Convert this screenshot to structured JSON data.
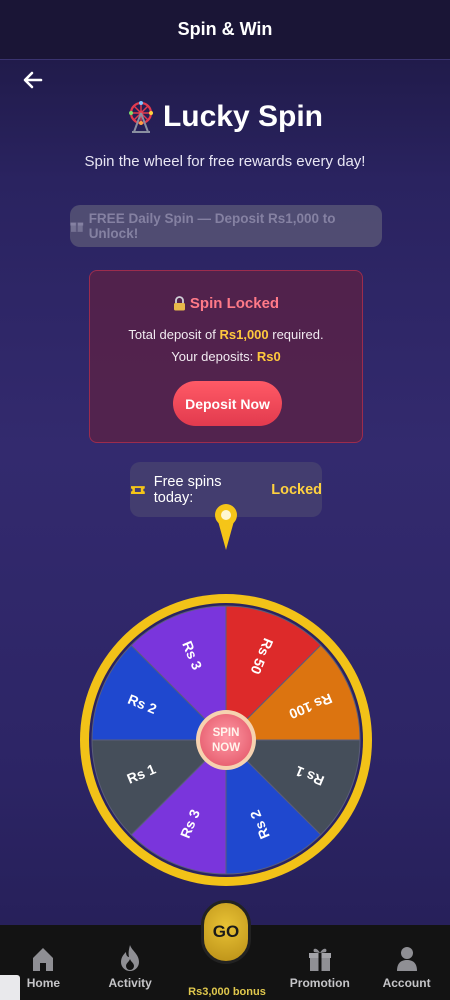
{
  "header": {
    "title": "Spin & Win"
  },
  "hero": {
    "title": "Lucky Spin",
    "subtitle": "Spin the wheel for free rewards every day!"
  },
  "free_daily": {
    "label": "FREE Daily Spin — Deposit Rs1,000 to Unlock!"
  },
  "lock_card": {
    "title": "Spin Locked",
    "line1_prefix": "Total deposit of ",
    "line1_amount": "Rs1,000",
    "line1_suffix": " required.",
    "line2_prefix": "Your deposits: ",
    "line2_amount": "Rs0",
    "button": "Deposit Now"
  },
  "status": {
    "label": "Free spins today:",
    "value": "Locked"
  },
  "wheel": {
    "center_line1": "SPIN",
    "center_line2": "NOW",
    "segments": [
      {
        "label": "Rs 50",
        "color": "#dd2a2a"
      },
      {
        "label": "Rs 100",
        "color": "#dc7410"
      },
      {
        "label": "Rs 1",
        "color": "#454e5a"
      },
      {
        "label": "Rs 2",
        "color": "#1f48cf"
      },
      {
        "label": "Rs 3",
        "color": "#7a35dc"
      },
      {
        "label": "Rs 1",
        "color": "#454e5a"
      },
      {
        "label": "Rs 2",
        "color": "#1f48cf"
      },
      {
        "label": "Rs 3",
        "color": "#7a35dc"
      }
    ],
    "rim_color": "#f2c218",
    "pointer_color": "#f5c518"
  },
  "bottom_nav": {
    "items": [
      {
        "label": "Home",
        "icon": "home-icon"
      },
      {
        "label": "Activity",
        "icon": "flame-icon"
      },
      {
        "label": "Promotion",
        "icon": "gift-icon"
      },
      {
        "label": "Account",
        "icon": "user-icon"
      }
    ],
    "go": {
      "label": "GO",
      "bonus": "Rs3,000 bonus"
    }
  }
}
